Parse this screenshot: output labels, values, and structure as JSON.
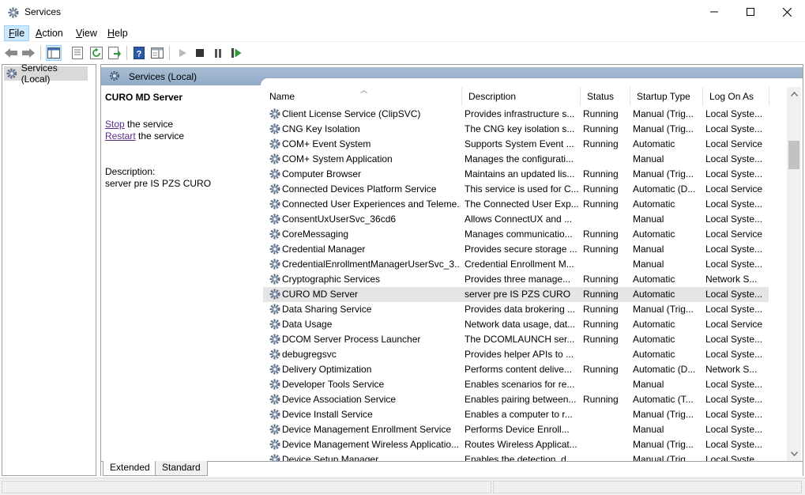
{
  "window": {
    "title": "Services",
    "icon": "gear-icon"
  },
  "menu": {
    "items": [
      {
        "label": "File",
        "underline": "F",
        "rest": "ile"
      },
      {
        "label": "Action",
        "underline": "A",
        "rest": "ction"
      },
      {
        "label": "View",
        "underline": "V",
        "rest": "iew"
      },
      {
        "label": "Help",
        "underline": "H",
        "rest": "elp"
      }
    ]
  },
  "toolbar": {
    "icons": [
      "back-arrow-icon",
      "forward-arrow-icon",
      "show-hide-console-tree-icon",
      "properties-icon",
      "refresh-icon",
      "export-list-icon",
      "help-icon",
      "show-hide-action-pane-icon",
      "start-service-icon",
      "stop-service-icon",
      "pause-service-icon",
      "resume-service-icon"
    ]
  },
  "tree": {
    "root_label": "Services (Local)"
  },
  "pane": {
    "header_title": "Services (Local)",
    "selected_service": "CURO MD Server",
    "stop_link": "Stop",
    "stop_rest": " the service",
    "restart_link": "Restart",
    "restart_rest": " the service",
    "description_label": "Description:",
    "description_text": "server pre IS PZS CURO"
  },
  "columns": [
    "Name",
    "Description",
    "Status",
    "Startup Type",
    "Log On As"
  ],
  "rows": [
    [
      "Client License Service (ClipSVC)",
      "Provides infrastructure s...",
      "Running",
      "Manual (Trig...",
      "Local Syste..."
    ],
    [
      "CNG Key Isolation",
      "The CNG key isolation s...",
      "Running",
      "Manual (Trig...",
      "Local Syste..."
    ],
    [
      "COM+ Event System",
      "Supports System Event ...",
      "Running",
      "Automatic",
      "Local Service"
    ],
    [
      "COM+ System Application",
      "Manages the configurati...",
      "",
      "Manual",
      "Local Syste..."
    ],
    [
      "Computer Browser",
      "Maintains an updated lis...",
      "Running",
      "Manual (Trig...",
      "Local Syste..."
    ],
    [
      "Connected Devices Platform Service",
      "This service is used for C...",
      "Running",
      "Automatic (D...",
      "Local Service"
    ],
    [
      "Connected User Experiences and Teleme...",
      "The Connected User Exp...",
      "Running",
      "Automatic",
      "Local Syste..."
    ],
    [
      "ConsentUxUserSvc_36cd6",
      "Allows ConnectUX and ...",
      "",
      "Manual",
      "Local Syste..."
    ],
    [
      "CoreMessaging",
      "Manages communicatio...",
      "Running",
      "Automatic",
      "Local Service"
    ],
    [
      "Credential Manager",
      "Provides secure storage ...",
      "Running",
      "Manual",
      "Local Syste..."
    ],
    [
      "CredentialEnrollmentManagerUserSvc_3...",
      "Credential Enrollment M...",
      "",
      "Manual",
      "Local Syste..."
    ],
    [
      "Cryptographic Services",
      "Provides three manage...",
      "Running",
      "Automatic",
      "Network S..."
    ],
    [
      "CURO MD Server",
      "server pre IS PZS CURO",
      "Running",
      "Automatic",
      "Local Syste..."
    ],
    [
      "Data Sharing Service",
      "Provides data brokering ...",
      "Running",
      "Manual (Trig...",
      "Local Syste..."
    ],
    [
      "Data Usage",
      "Network data usage, dat...",
      "Running",
      "Automatic",
      "Local Service"
    ],
    [
      "DCOM Server Process Launcher",
      "The DCOMLAUNCH ser...",
      "Running",
      "Automatic",
      "Local Syste..."
    ],
    [
      "debugregsvc",
      "Provides helper APIs to ...",
      "",
      "Automatic",
      "Local Syste..."
    ],
    [
      "Delivery Optimization",
      "Performs content delive...",
      "Running",
      "Automatic (D...",
      "Network S..."
    ],
    [
      "Developer Tools Service",
      "Enables scenarios for re...",
      "",
      "Manual",
      "Local Syste..."
    ],
    [
      "Device Association Service",
      "Enables pairing between...",
      "Running",
      "Automatic (T...",
      "Local Syste..."
    ],
    [
      "Device Install Service",
      "Enables a computer to r...",
      "",
      "Manual (Trig...",
      "Local Syste..."
    ],
    [
      "Device Management Enrollment Service",
      "Performs Device Enroll...",
      "",
      "Manual",
      "Local Syste..."
    ],
    [
      "Device Management Wireless Applicatio...",
      "Routes Wireless Applicat...",
      "",
      "Manual (Trig...",
      "Local Syste..."
    ],
    [
      "Device Setup Manager",
      "Enables the detection, d...",
      "",
      "Manual (Trig...",
      "Local Syste..."
    ]
  ],
  "selected_row_index": 12,
  "tabs": [
    "Extended",
    "Standard"
  ],
  "colors": {
    "header_gradient_top": "#a9bdd3",
    "header_gradient_bottom": "#91abc8",
    "selection": "#e5e5e5",
    "link": "#5a2c8c",
    "active_menu": "#cce8ff"
  }
}
